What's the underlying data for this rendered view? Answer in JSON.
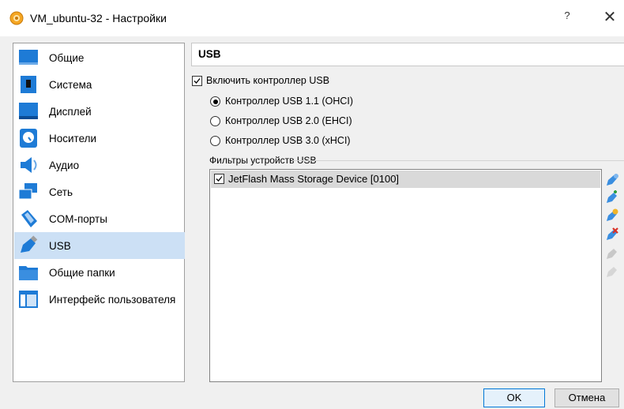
{
  "window": {
    "title": "VM_ubuntu-32 - Настройки",
    "help": "?",
    "close": "✕"
  },
  "sidebar": {
    "items": [
      {
        "label": "Общие",
        "icon": "general-icon"
      },
      {
        "label": "Система",
        "icon": "system-icon"
      },
      {
        "label": "Дисплей",
        "icon": "display-icon"
      },
      {
        "label": "Носители",
        "icon": "storage-icon"
      },
      {
        "label": "Аудио",
        "icon": "audio-icon"
      },
      {
        "label": "Сеть",
        "icon": "network-icon"
      },
      {
        "label": "COM-порты",
        "icon": "serial-ports-icon"
      },
      {
        "label": "USB",
        "icon": "usb-icon",
        "selected": true
      },
      {
        "label": "Общие папки",
        "icon": "shared-folders-icon"
      },
      {
        "label": "Интерфейс пользователя",
        "icon": "user-interface-icon"
      }
    ]
  },
  "usb": {
    "section_title": "USB",
    "enable_label": "Включить контроллер USB",
    "enable_checked": true,
    "controllers": [
      {
        "label": "Контроллер USB 1.1 (OHCI)",
        "selected": true
      },
      {
        "label": "Контроллер USB 2.0 (EHCI)",
        "selected": false
      },
      {
        "label": "Контроллер USB 3.0 (xHCI)",
        "selected": false
      }
    ],
    "filters_label": "Фильтры устройств USB",
    "filters": [
      {
        "label": "JetFlash Mass Storage Device [0100]",
        "checked": true
      }
    ],
    "tools": [
      {
        "name": "add-empty-filter-icon",
        "enabled": true
      },
      {
        "name": "add-filter-from-device-icon",
        "enabled": true
      },
      {
        "name": "edit-filter-icon",
        "enabled": true
      },
      {
        "name": "remove-filter-icon",
        "enabled": true
      },
      {
        "name": "move-filter-up-icon",
        "enabled": false
      },
      {
        "name": "move-filter-down-icon",
        "enabled": false
      }
    ]
  },
  "buttons": {
    "ok": "OK",
    "cancel": "Отмена"
  },
  "colors": {
    "selection": "#cce0f5",
    "accent": "#0078d7",
    "icon_blue": "#1e7bd6"
  }
}
